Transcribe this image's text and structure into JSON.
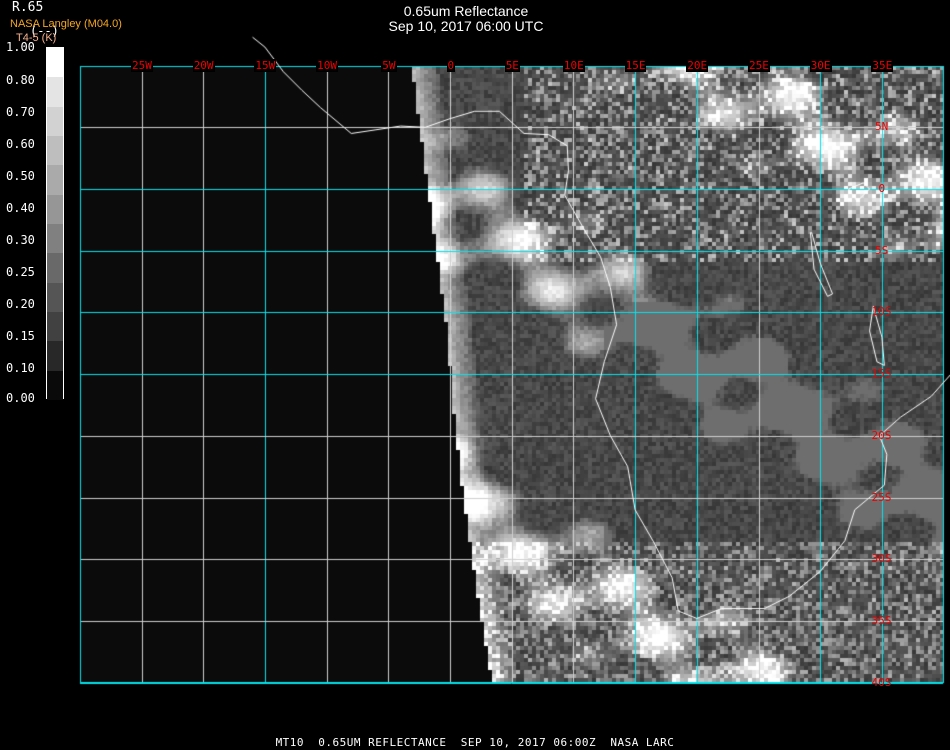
{
  "header": {
    "title": "0.65um Reflectance",
    "subtitle": "Sep 10, 2017 06:00 UTC"
  },
  "legend": {
    "product": "R.65",
    "product_unit": "(--)",
    "source": "NASA Langley (M04.0)",
    "overlay_label": "T4-5 (K)",
    "ticks": [
      "1.00",
      "0.80",
      "0.70",
      "0.60",
      "0.50",
      "0.40",
      "0.30",
      "0.25",
      "0.20",
      "0.15",
      "0.10",
      "0.00"
    ]
  },
  "grid": {
    "lon_labels": [
      "25W",
      "20W",
      "15W",
      "10W",
      "5W",
      "0",
      "5E",
      "10E",
      "15E",
      "20E",
      "25E",
      "30E",
      "35E"
    ],
    "lon_values": [
      -25,
      -20,
      -15,
      -10,
      -5,
      0,
      5,
      10,
      15,
      20,
      25,
      30,
      35
    ],
    "lat_labels": [
      "5N",
      "0",
      "5S",
      "10S",
      "15S",
      "20S",
      "25S",
      "30S",
      "35S",
      "40S"
    ],
    "lat_values": [
      5,
      0,
      -5,
      -10,
      -15,
      -20,
      -25,
      -30,
      -35,
      -40
    ],
    "line_color": "#00e5ee",
    "label_color": "#ee0000",
    "coast_color": "#ffffff"
  },
  "footer": "MT10  0.65UM REFLECTANCE  SEP 10, 2017 06:00Z  NASA LARC"
}
